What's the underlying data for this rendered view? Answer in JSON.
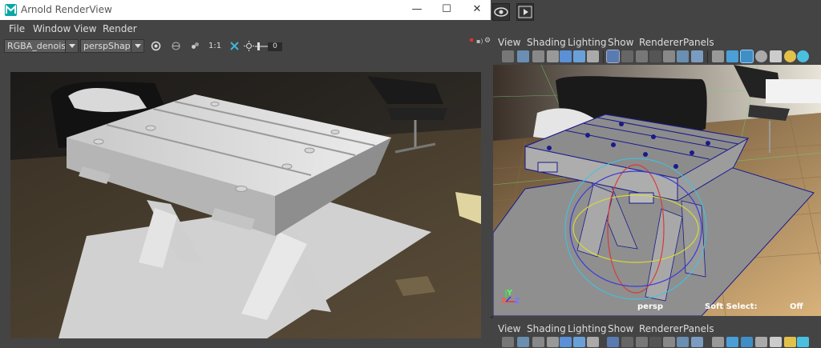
{
  "arnold": {
    "title": "Arnold RenderView",
    "window_controls": {
      "minimize": "—",
      "maximize": "☐",
      "close": "✕"
    },
    "menu": [
      "File",
      "Window",
      "View",
      "Render"
    ],
    "toolbar": {
      "aov": "RGBA_denoise",
      "camera": "perspShape",
      "ratio": "1:1",
      "exposure": "0"
    }
  },
  "viewport_top": {
    "menu": [
      "View",
      "Shading",
      "Lighting",
      "Show",
      "Renderer",
      "Panels"
    ]
  },
  "viewport_bottom": {
    "menu": [
      "View",
      "Shading",
      "Lighting",
      "Show",
      "Renderer",
      "Panels"
    ]
  },
  "hud": {
    "camera": "persp",
    "soft_select_label": "Soft Select:",
    "soft_select_value": "Off",
    "axis_x": "X",
    "axis_y": "Y",
    "axis_z": "Z"
  },
  "colors": {
    "ui_bg": "#444444",
    "accent_teal": "#0aa6a6",
    "wire_blue": "#1a1a8c",
    "grid_green": "#6fd66f",
    "selection_cyan": "#39c6e6"
  }
}
